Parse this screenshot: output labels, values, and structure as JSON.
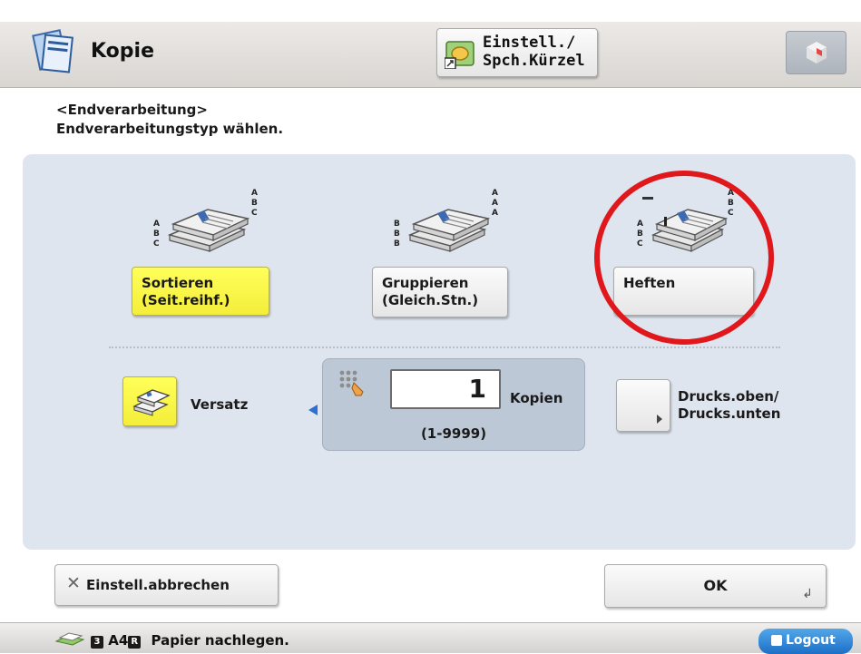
{
  "header": {
    "app_title": "Kopie",
    "app_icon": "copy-documents-icon",
    "shortcut_button": {
      "line1": "Einstell./",
      "line2": "Spch.Kürzel",
      "icon": "settings-shortcut-icon"
    },
    "cube_button_icon": "cube-icon"
  },
  "instructions": {
    "title": "<Endverarbeitung>",
    "text": "Endverarbeitungstyp wählen."
  },
  "finishing_options": [
    {
      "id": "collate",
      "label": "Sortieren\n(Seit.reihf.)",
      "selected": true,
      "icon": "collate-stack-icon"
    },
    {
      "id": "group",
      "label": "Gruppieren\n(Gleich.Stn.)",
      "selected": false,
      "icon": "group-stack-icon"
    },
    {
      "id": "staple",
      "label": "Heften",
      "selected": false,
      "icon": "staple-stack-icon"
    }
  ],
  "offset": {
    "label": "Versatz",
    "selected": true,
    "icon": "offset-stack-icon"
  },
  "copies": {
    "value": "1",
    "unit": "Kopien",
    "range": "(1-9999)",
    "icon": "keypad-icon"
  },
  "face": {
    "label": "Drucks.oben/\nDrucks.unten",
    "icon": "expand-arrow-icon"
  },
  "footer": {
    "cancel_label": "Einstell.abbrechen",
    "ok_label": "OK"
  },
  "status": {
    "paper_icon": "paper-tray-icon",
    "tray_number": "3",
    "paper_size": "A4",
    "paper_orientation": "R",
    "message": "Papier nachlegen.",
    "logout_label": "Logout"
  },
  "colors": {
    "selected": "#f7f23c",
    "panel": "#dfe5ee",
    "accent": "#2d6fd2",
    "highlight_circle": "#e0171b"
  }
}
